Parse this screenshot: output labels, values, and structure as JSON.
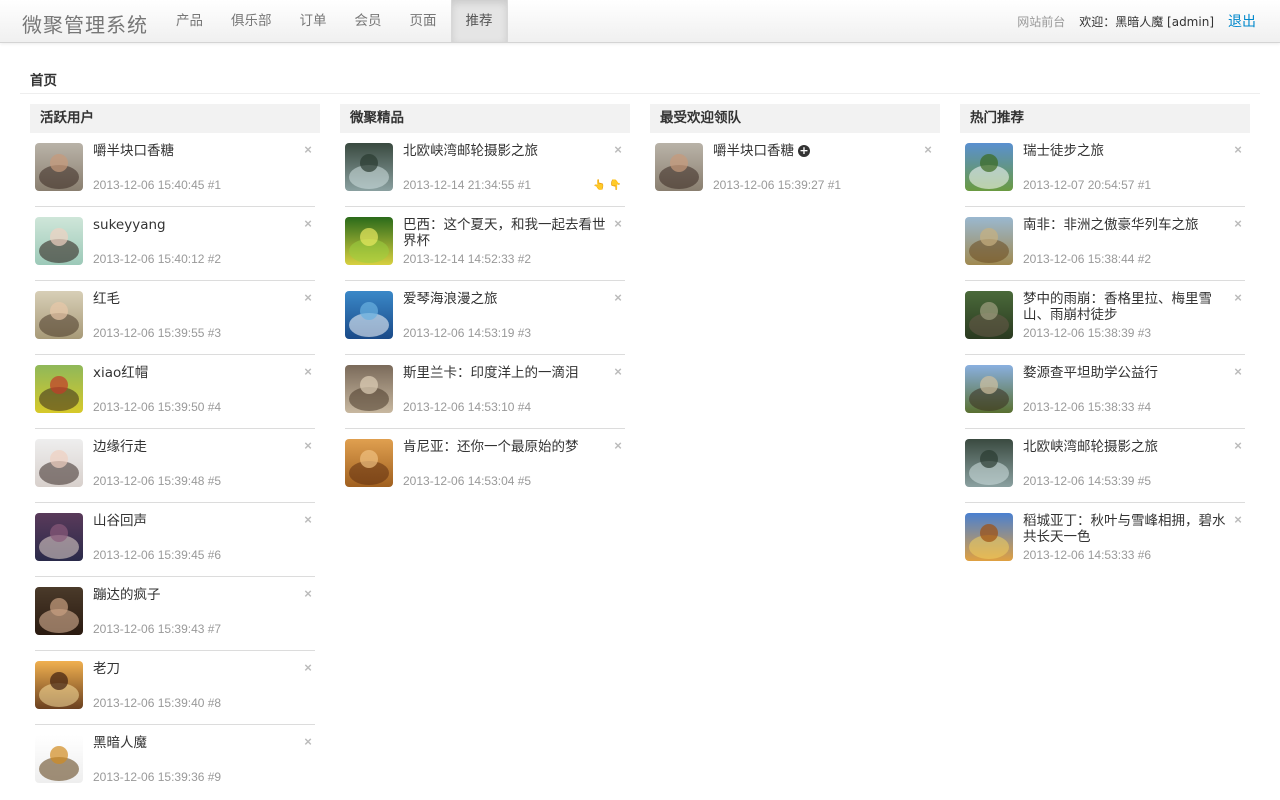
{
  "app": {
    "brand": "微聚管理系统",
    "nav": [
      "产品",
      "俱乐部",
      "订单",
      "会员",
      "页面",
      "推荐"
    ],
    "front_link": "网站前台",
    "welcome": "欢迎：黑暗人魔 [admin]",
    "logout": "退出"
  },
  "breadcrumb": "首页",
  "columns": [
    {
      "title": "活跃用户",
      "items": [
        {
          "title": "嚼半块口香糖",
          "meta": "2013-12-06 15:40:45 #1"
        },
        {
          "title": "sukeyyang",
          "meta": "2013-12-06 15:40:12 #2"
        },
        {
          "title": "红毛",
          "meta": "2013-12-06 15:39:55 #3"
        },
        {
          "title": "xiao红帽",
          "meta": "2013-12-06 15:39:50 #4"
        },
        {
          "title": "边缘行走",
          "meta": "2013-12-06 15:39:48 #5"
        },
        {
          "title": "山谷回声",
          "meta": "2013-12-06 15:39:45 #6"
        },
        {
          "title": "蹦达的疯子",
          "meta": "2013-12-06 15:39:43 #7"
        },
        {
          "title": "老刀",
          "meta": "2013-12-06 15:39:40 #8"
        },
        {
          "title": "黑暗人魔",
          "meta": "2013-12-06 15:39:36 #9"
        }
      ]
    },
    {
      "title": "微聚精品",
      "items": [
        {
          "title": "北欧峡湾邮轮摄影之旅",
          "meta": "2013-12-14 21:34:55 #1"
        },
        {
          "title": "巴西：这个夏天，和我一起去看世界杯",
          "meta": "2013-12-14 14:52:33 #2"
        },
        {
          "title": "爱琴海浪漫之旅",
          "meta": "2013-12-06 14:53:19 #3"
        },
        {
          "title": "斯里兰卡：印度洋上的一滴泪",
          "meta": "2013-12-06 14:53:10 #4"
        },
        {
          "title": "肯尼亚：还你一个最原始的梦",
          "meta": "2013-12-06 14:53:04 #5"
        }
      ]
    },
    {
      "title": "最受欢迎领队",
      "items": [
        {
          "title": "嚼半块口香糖",
          "meta": "2013-12-06 15:39:27 #1"
        }
      ]
    },
    {
      "title": "热门推荐",
      "items": [
        {
          "title": "瑞士徒步之旅",
          "meta": "2013-12-07 20:54:57 #1"
        },
        {
          "title": "南非：非洲之傲豪华列车之旅",
          "meta": "2013-12-06 15:38:44 #2"
        },
        {
          "title": "梦中的雨崩：香格里拉、梅里雪山、雨崩村徒步",
          "meta": "2013-12-06 15:38:39 #3"
        },
        {
          "title": "婺源查平坦助学公益行",
          "meta": "2013-12-06 15:38:33 #4"
        },
        {
          "title": "北欧峡湾邮轮摄影之旅",
          "meta": "2013-12-06 14:53:39 #5"
        },
        {
          "title": "稻城亚丁：秋叶与雪峰相拥，碧水共长天一色",
          "meta": "2013-12-06 14:53:33 #6"
        }
      ]
    }
  ],
  "icons": {
    "close": "close-icon",
    "add": "plus-circle-icon",
    "thumb_up": "thumb-up-icon",
    "thumb_down": "thumb-down-icon"
  },
  "colors": {
    "accent": "#0088cc",
    "meta": "#999999",
    "header_bg": "#f2f2f2"
  }
}
